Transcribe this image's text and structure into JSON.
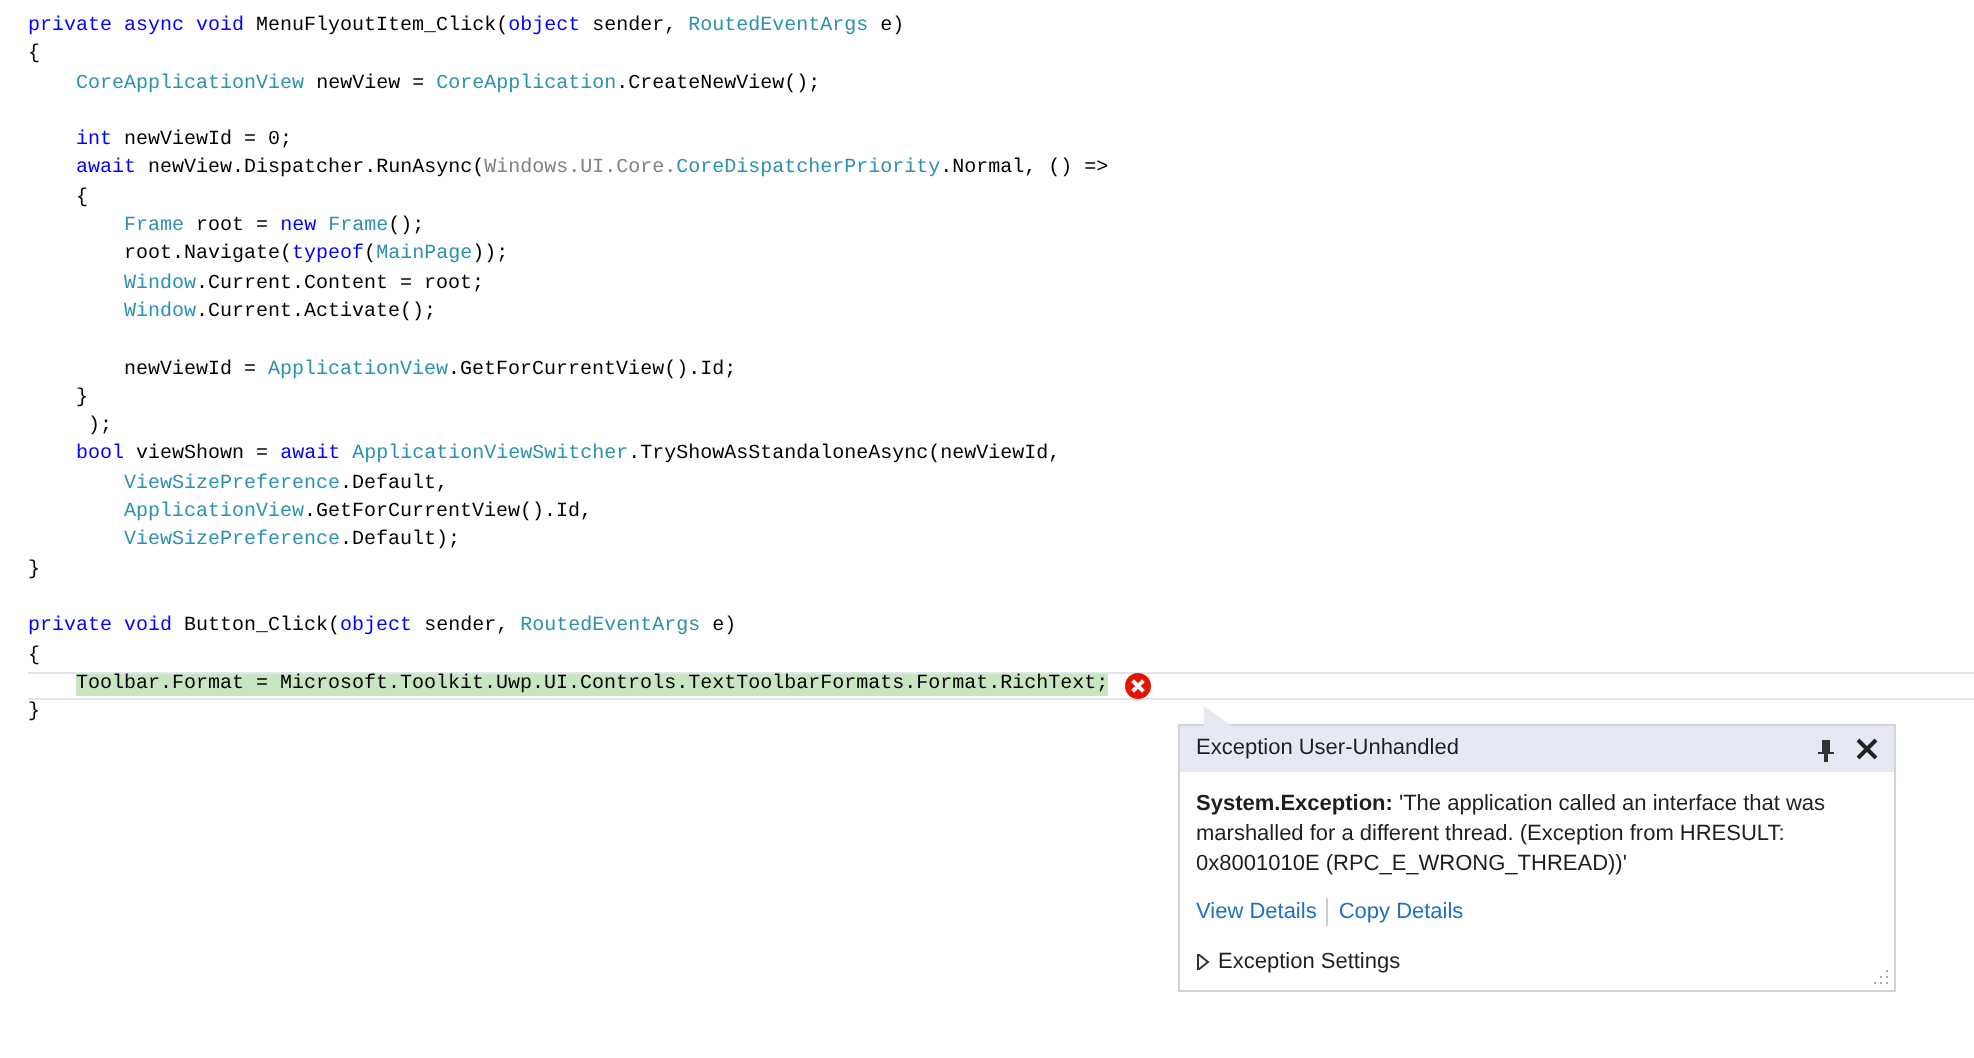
{
  "code_blocks": [
    [
      [
        {
          "t": "private async void",
          "kind": "kw"
        },
        {
          "t": " MenuFlyoutItem_Click(",
          "kind": "plain"
        },
        {
          "t": "object",
          "kind": "kw"
        },
        {
          "t": " sender, ",
          "kind": "plain"
        },
        {
          "t": "RoutedEventArgs",
          "kind": "type"
        },
        {
          "t": " e)",
          "kind": "plain"
        }
      ],
      [
        {
          "t": "{",
          "kind": "plain"
        }
      ],
      [
        {
          "t": "    CoreApplicationView",
          "kind": "type"
        },
        {
          "t": " newView = ",
          "kind": "plain"
        },
        {
          "t": "CoreApplication",
          "kind": "type"
        },
        {
          "t": ".CreateNewView();",
          "kind": "plain"
        }
      ]
    ],
    [
      [
        {
          "t": "    int",
          "kind": "kw"
        },
        {
          "t": " newViewId = 0;",
          "kind": "plain"
        }
      ],
      [
        {
          "t": "    await",
          "kind": "kw"
        },
        {
          "t": " newView.Dispatcher.RunAsync(",
          "kind": "plain"
        },
        {
          "t": "Windows.UI.Core.",
          "kind": "dim"
        },
        {
          "t": "CoreDispatcherPriority",
          "kind": "type"
        },
        {
          "t": ".Normal, () =>",
          "kind": "plain"
        }
      ],
      [
        {
          "t": "    {",
          "kind": "plain"
        }
      ],
      [
        {
          "t": "        Frame",
          "kind": "type"
        },
        {
          "t": " root = ",
          "kind": "plain"
        },
        {
          "t": "new ",
          "kind": "kw"
        },
        {
          "t": "Frame",
          "kind": "type"
        },
        {
          "t": "();",
          "kind": "plain"
        }
      ],
      [
        {
          "t": "        root.Navigate(",
          "kind": "plain"
        },
        {
          "t": "typeof",
          "kind": "kw"
        },
        {
          "t": "(",
          "kind": "plain"
        },
        {
          "t": "MainPage",
          "kind": "type"
        },
        {
          "t": "));",
          "kind": "plain"
        }
      ],
      [
        {
          "t": "        Window",
          "kind": "type"
        },
        {
          "t": ".Current.Content = root;",
          "kind": "plain"
        }
      ],
      [
        {
          "t": "        Window",
          "kind": "type"
        },
        {
          "t": ".Current.Activate();",
          "kind": "plain"
        }
      ]
    ],
    [
      [
        {
          "t": "        newViewId = ",
          "kind": "plain"
        },
        {
          "t": "ApplicationView",
          "kind": "type"
        },
        {
          "t": ".GetForCurrentView().Id;",
          "kind": "plain"
        }
      ],
      [
        {
          "t": "    }",
          "kind": "plain"
        }
      ],
      [
        {
          "t": "     );",
          "kind": "plain"
        }
      ],
      [
        {
          "t": "    bool",
          "kind": "kw"
        },
        {
          "t": " viewShown = ",
          "kind": "plain"
        },
        {
          "t": "await ",
          "kind": "kw"
        },
        {
          "t": "ApplicationViewSwitcher",
          "kind": "type"
        },
        {
          "t": ".TryShowAsStandaloneAsync(newViewId,",
          "kind": "plain"
        }
      ],
      [
        {
          "t": "        ViewSizePreference",
          "kind": "type"
        },
        {
          "t": ".Default,",
          "kind": "plain"
        }
      ],
      [
        {
          "t": "        ApplicationView",
          "kind": "type"
        },
        {
          "t": ".GetForCurrentView().Id,",
          "kind": "plain"
        }
      ],
      [
        {
          "t": "        ViewSizePreference",
          "kind": "type"
        },
        {
          "t": ".Default);",
          "kind": "plain"
        }
      ],
      [
        {
          "t": "}",
          "kind": "plain"
        }
      ]
    ],
    [
      [
        {
          "t": "private void",
          "kind": "kw"
        },
        {
          "t": " Button_Click(",
          "kind": "plain"
        },
        {
          "t": "object",
          "kind": "kw"
        },
        {
          "t": " sender, ",
          "kind": "plain"
        },
        {
          "t": "RoutedEventArgs",
          "kind": "type"
        },
        {
          "t": " e)",
          "kind": "plain"
        }
      ],
      [
        {
          "t": "{",
          "kind": "plain"
        }
      ],
      [
        {
          "t": "    Toolbar.Format = Microsoft.Toolkit.Uwp.UI.Controls.TextToolbarFormats.Format.RichText;",
          "kind": "highlight"
        }
      ],
      [
        {
          "t": "}",
          "kind": "plain"
        }
      ]
    ]
  ],
  "exception_popup": {
    "title": "Exception User-Unhandled",
    "message": "**System.Exception:** 'The application called an interface that was marshalled for a different thread. (Exception from HRESULT: 0x8001010E (RPC_E_WRONG_THREAD))'",
    "links": [
      "View Details",
      "Copy Details"
    ],
    "settings": {
      "label": "Exception Settings",
      "expanded": false
    }
  }
}
